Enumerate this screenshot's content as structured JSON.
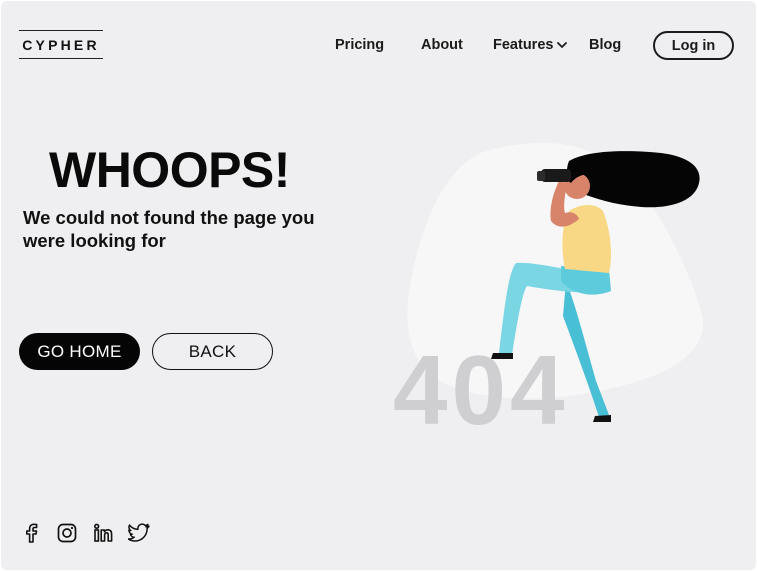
{
  "brand": {
    "name": "CYPHER"
  },
  "nav": {
    "pricing": "Pricing",
    "about": "About",
    "features": "Features",
    "blog": "Blog",
    "login": "Log in"
  },
  "hero": {
    "title": "WHOOPS!",
    "subtitle": "We could not found the page you were looking for"
  },
  "actions": {
    "home": "GO HOME",
    "back": "BACK"
  },
  "error_code": "404",
  "social": [
    {
      "icon": "facebook-icon"
    },
    {
      "icon": "instagram-icon"
    },
    {
      "icon": "linkedin-icon"
    },
    {
      "icon": "twitter-icon"
    }
  ],
  "colors": {
    "background": "#efeff1",
    "primary": "#050505",
    "code_404": "#cfcfd1",
    "pants": "#5ecbdc",
    "shirt": "#f9d885",
    "skin": "#d8846a",
    "hair": "#050505"
  }
}
